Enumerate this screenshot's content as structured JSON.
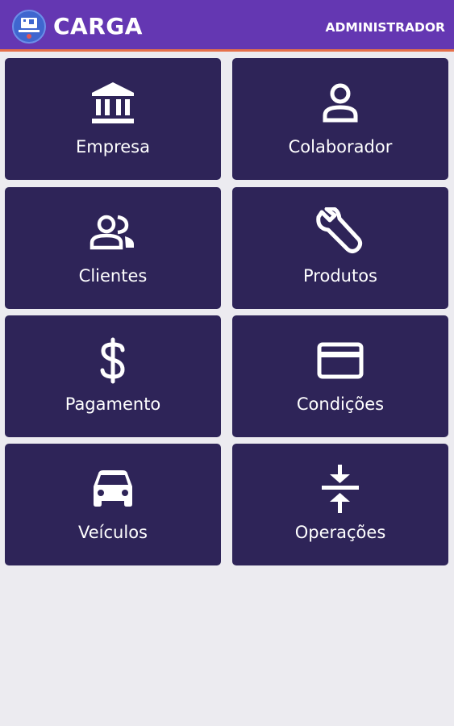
{
  "header": {
    "title": "CARGA",
    "account_label": "ADMINISTRADOR",
    "logo_icon": "app-logo-icon"
  },
  "colors": {
    "appbar": "#6437b2",
    "appbar_accent": "#e6704a",
    "tile": "#2e2458",
    "background": "#ecebf0"
  },
  "menu": {
    "items": [
      {
        "label": "Empresa",
        "icon": "bank-icon"
      },
      {
        "label": "Colaborador",
        "icon": "person-icon"
      },
      {
        "label": "Clientes",
        "icon": "people-icon"
      },
      {
        "label": "Produtos",
        "icon": "wrench-icon"
      },
      {
        "label": "Pagamento",
        "icon": "dollar-icon"
      },
      {
        "label": "Condições",
        "icon": "credit-card-icon"
      },
      {
        "label": "Veículos",
        "icon": "car-icon"
      },
      {
        "label": "Operações",
        "icon": "compress-arrows-icon"
      }
    ]
  }
}
